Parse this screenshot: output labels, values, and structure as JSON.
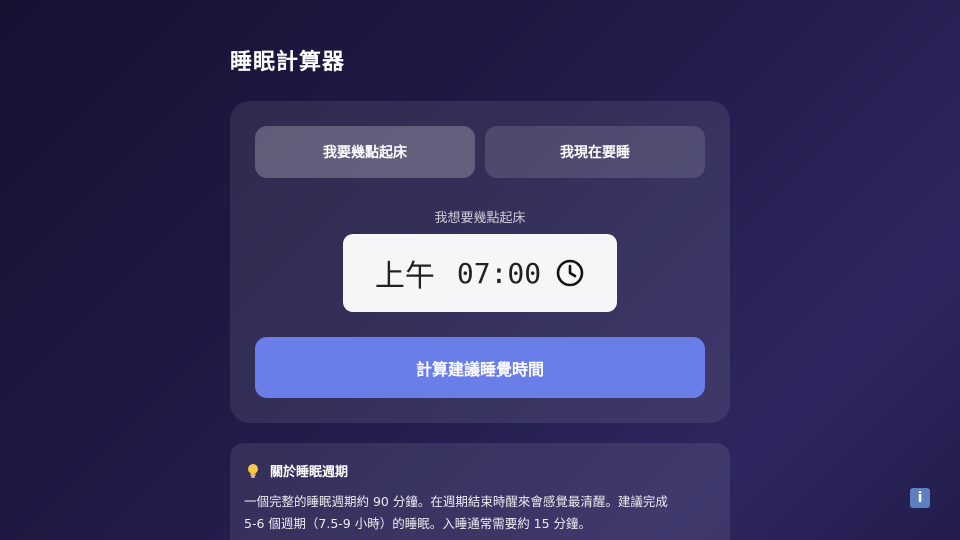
{
  "page": {
    "title": "睡眠計算器"
  },
  "mode_tabs": {
    "wake_label": "我要幾點起床",
    "sleep_now_label": "我現在要睡"
  },
  "time_picker": {
    "label": "我想要幾點起床",
    "ampm": "上午",
    "value": "07:00",
    "icon": "clock-icon"
  },
  "actions": {
    "calculate_label": "計算建議睡覺時間",
    "accent_color": "#6a7eea"
  },
  "info": {
    "icon": "lightbulb-icon",
    "title": "關於睡眠週期",
    "line1": "一個完整的睡眠週期約 90 分鐘。在週期結束時醒來會感覺最清醒。建議完成",
    "line2": "5-6 個週期（7.5-9 小時）的睡眠。入睡通常需要約 15 分鐘。",
    "fab_label": "i"
  }
}
